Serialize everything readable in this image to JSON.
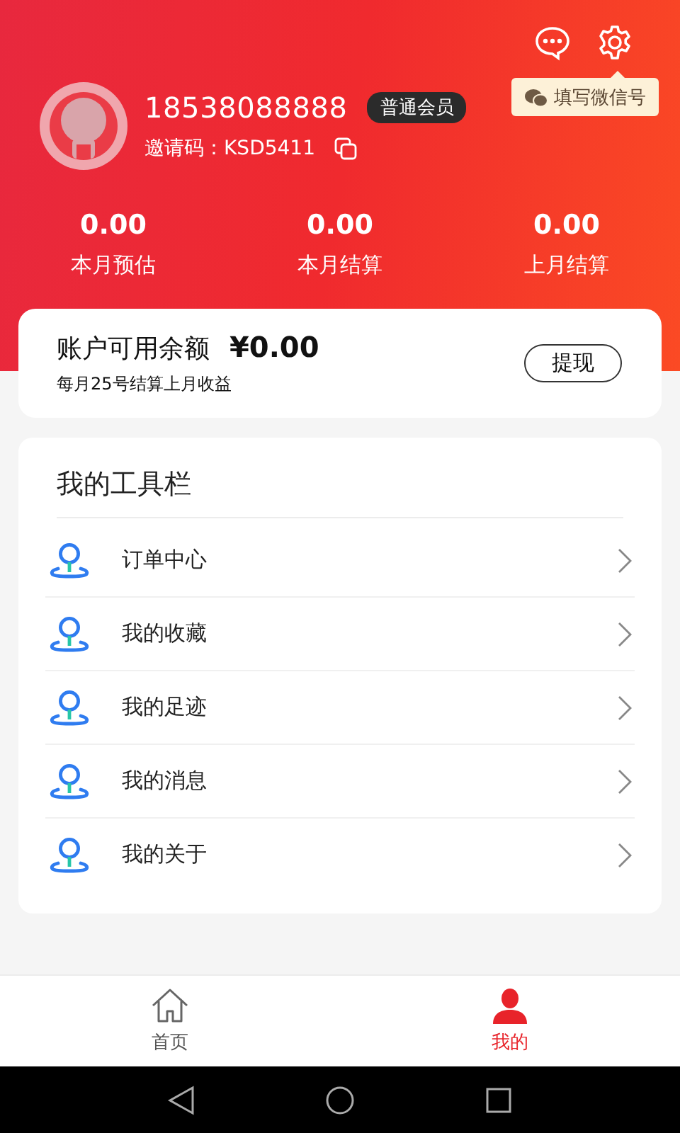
{
  "header": {
    "phone": "18538088888",
    "member_badge": "普通会员",
    "invite": "邀请码：KSD5411",
    "wechat_tip": "填写微信号"
  },
  "stats": [
    {
      "value": "0.00",
      "label": "本月预估"
    },
    {
      "value": "0.00",
      "label": "本月结算"
    },
    {
      "value": "0.00",
      "label": "上月结算"
    }
  ],
  "balance": {
    "label": "账户可用余额",
    "amount": "¥0.00",
    "note": "每月25号结算上月收益",
    "button": "提现"
  },
  "toolbar": {
    "title": "我的工具栏",
    "items": [
      {
        "label": "订单中心"
      },
      {
        "label": "我的收藏"
      },
      {
        "label": "我的足迹"
      },
      {
        "label": "我的消息"
      },
      {
        "label": "我的关于"
      }
    ]
  },
  "tabs": [
    {
      "kind": "home",
      "label": "首页",
      "selected": false
    },
    {
      "kind": "profile",
      "label": "我的",
      "selected": true
    }
  ]
}
